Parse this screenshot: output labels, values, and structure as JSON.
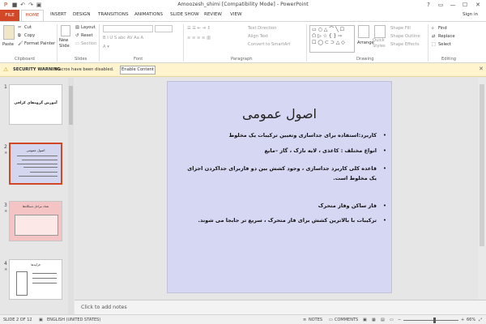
{
  "app": {
    "title": "Amoozesh_shimi [Compatibility Mode] - PowerPoint",
    "window_controls": [
      "?",
      "▭",
      "—",
      "☐",
      "✕"
    ],
    "sign_in": "Sign in"
  },
  "tabs": [
    "FILE",
    "HOME",
    "INSERT",
    "DESIGN",
    "TRANSITIONS",
    "ANIMATIONS",
    "SLIDE SHOW",
    "REVIEW",
    "VIEW"
  ],
  "ribbon": {
    "clipboard": {
      "paste": "Paste",
      "cut": "Cut",
      "copy": "Copy",
      "format_painter": "Format Painter",
      "label": "Clipboard"
    },
    "slides": {
      "new_slide": "New Slide",
      "layout": "Layout",
      "reset": "Reset",
      "section": "Section",
      "label": "Slides"
    },
    "font": {
      "label": "Font"
    },
    "paragraph": {
      "text_direction": "Text Direction",
      "align_text": "Align Text",
      "convert_smartart": "Convert to SmartArt",
      "label": "Paragraph"
    },
    "drawing": {
      "arrange": "Arrange",
      "quick_styles": "Quick Styles",
      "shape_fill": "Shape Fill",
      "shape_outline": "Shape Outline",
      "shape_effects": "Shape Effects",
      "label": "Drawing"
    },
    "editing": {
      "find": "Find",
      "replace": "Replace",
      "select": "Select",
      "label": "Editing"
    }
  },
  "security_bar": {
    "label": "SECURITY WARNING",
    "message": "Macros have been disabled.",
    "button": "Enable Content"
  },
  "thumbnails": [
    {
      "number": "1",
      "title": "آموزش گروه‌های کرافی",
      "star": ""
    },
    {
      "number": "2",
      "title": "اصول عمومی",
      "star": "★"
    },
    {
      "number": "3",
      "title": "تعداد مراحل دستگاه‌ها",
      "star": "★"
    },
    {
      "number": "4",
      "title": "فرآیند‌ها",
      "star": "★"
    }
  ],
  "slide": {
    "title": "اصول عمومی",
    "bullets": [
      "كاربرد:استفاده براى جداسازى وتعيين تركيبات يک مخلوط",
      "انواع مختلف : كاغذى ، لايه نازک ، گاز –مايع",
      "قاعده كلى كاربرد جداسازى ، وجود كشش بين دو فازبراى جداكردن اجزاى يک مخلوط است.",
      "فاز ساكن وفاز متحرک",
      "تركيبات با بالاترين كشش براى فاز متحرک ، سريع تر جابجا مى شوند."
    ]
  },
  "notes_placeholder": "Click to add notes",
  "status": {
    "slide_info": "SLIDE 2 OF 12",
    "language": "ENGLISH (UNITED STATES)",
    "notes": "NOTES",
    "comments": "COMMENTS",
    "zoom": "66%"
  },
  "colors": {
    "accent": "#d24726",
    "slide_bg": "#d6d7f3",
    "security_bg": "#fff4ce"
  }
}
